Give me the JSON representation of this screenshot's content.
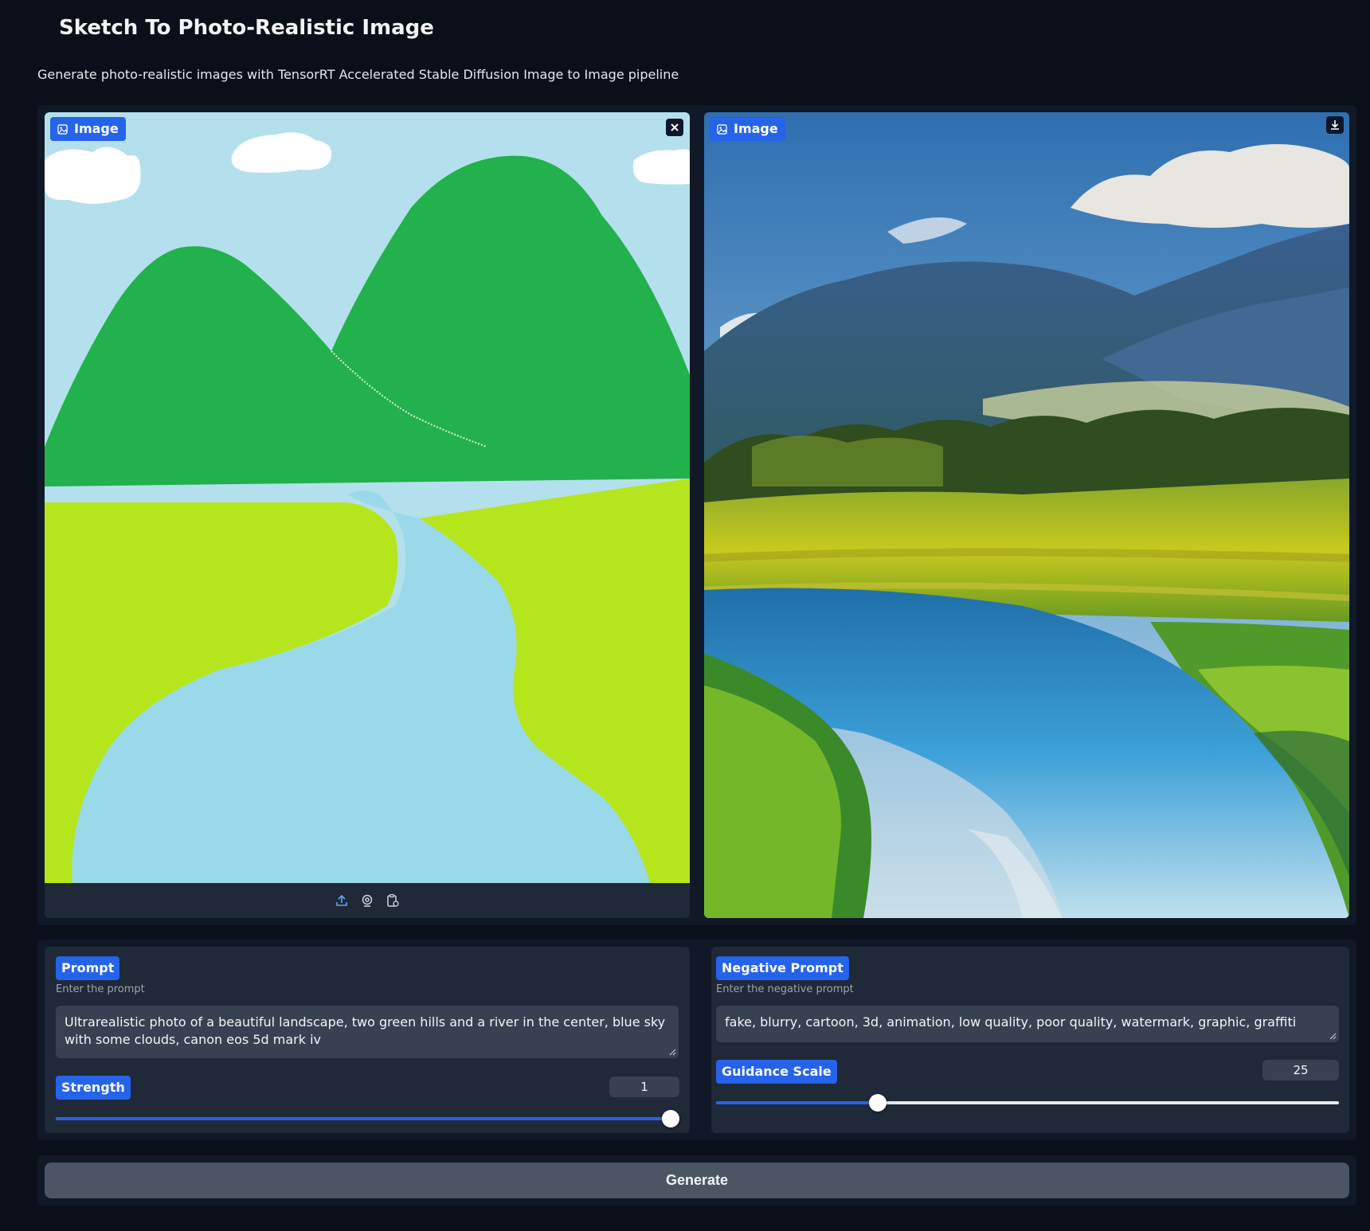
{
  "header": {
    "title": "Sketch To Photo-Realistic Image",
    "subtitle": "Generate photo-realistic images with TensorRT Accelerated Stable Diffusion Image to Image pipeline"
  },
  "input_image": {
    "label": "Image",
    "label_icon": "image-icon",
    "clear_icon": "close-icon",
    "toolbar_icons": [
      "upload-icon",
      "webcam-icon",
      "clipboard-icon"
    ]
  },
  "output_image": {
    "label": "Image",
    "label_icon": "image-icon",
    "download_icon": "download-icon"
  },
  "prompt": {
    "label": "Prompt",
    "hint": "Enter the prompt",
    "value": "Ultrarealistic photo of a beautiful landscape, two green hills and a river in the center, blue sky with some clouds, canon eos 5d mark iv"
  },
  "negative_prompt": {
    "label": "Negative Prompt",
    "hint": "Enter the negative prompt",
    "value": "fake, blurry, cartoon, 3d, animation, low quality, poor quality, watermark, graphic, graffiti"
  },
  "strength": {
    "label": "Strength",
    "value": "1",
    "fraction": 1.0
  },
  "guidance_scale": {
    "label": "Guidance Scale",
    "value": "25",
    "fraction": 0.26
  },
  "generate_button": {
    "label": "Generate"
  },
  "colors": {
    "background": "#0b0f19",
    "accent": "#2563eb",
    "panel": "#1f2937",
    "button": "#4b5563"
  }
}
